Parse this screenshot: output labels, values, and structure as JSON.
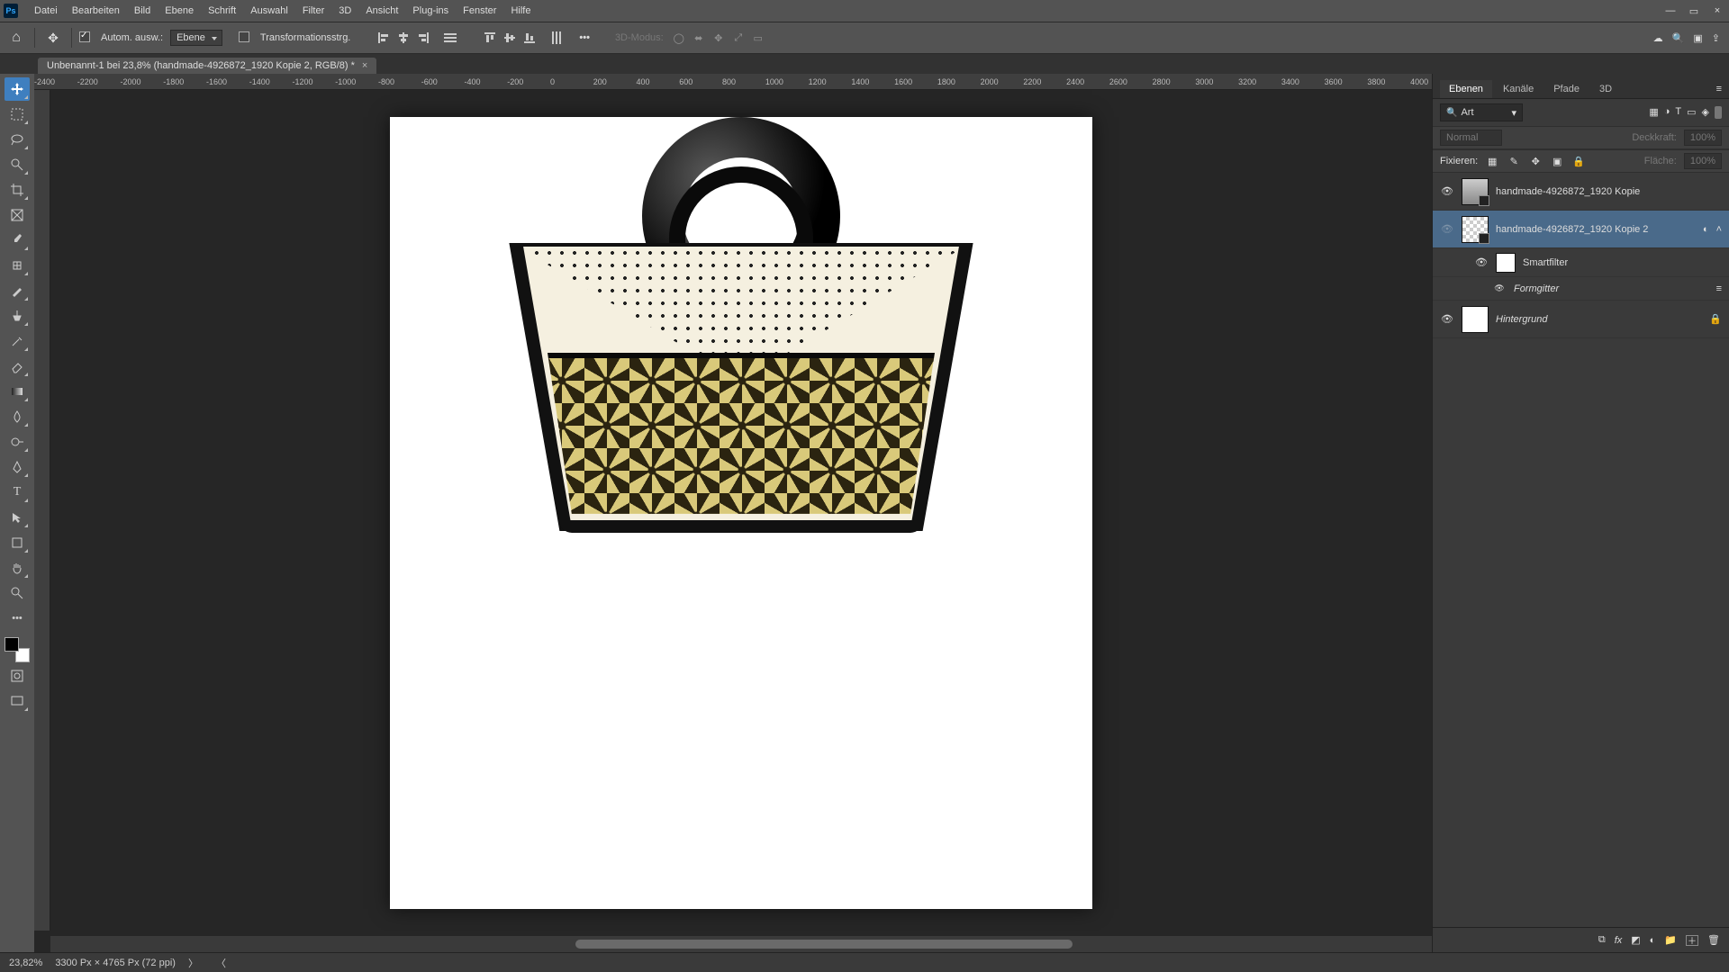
{
  "app": {
    "logo_text": "Ps"
  },
  "menu": {
    "items": [
      "Datei",
      "Bearbeiten",
      "Bild",
      "Ebene",
      "Schrift",
      "Auswahl",
      "Filter",
      "3D",
      "Ansicht",
      "Plug-ins",
      "Fenster",
      "Hilfe"
    ]
  },
  "options": {
    "auto_select_label": "Autom. ausw.:",
    "auto_select_target": "Ebene",
    "show_transform_label": "Transformationsstrg.",
    "threeD_mode_label": "3D-Modus:"
  },
  "document": {
    "tab_title": "Unbenannt-1 bei 23,8% (handmade-4926872_1920 Kopie 2, RGB/8) *"
  },
  "ruler": {
    "h_ticks": [
      "-2400",
      "-2200",
      "-2000",
      "-1800",
      "-1600",
      "-1400",
      "-1200",
      "-1000",
      "-800",
      "-600",
      "-400",
      "-200",
      "0",
      "200",
      "400",
      "600",
      "800",
      "1000",
      "1200",
      "1400",
      "1600",
      "1800",
      "2000",
      "2200",
      "2400",
      "2600",
      "2800",
      "3000",
      "3200",
      "3400",
      "3600",
      "3800",
      "4000"
    ]
  },
  "panels": {
    "tabs": [
      "Ebenen",
      "Kanäle",
      "Pfade",
      "3D"
    ],
    "search_mode": "Art",
    "blend_mode": "Normal",
    "opacity_label": "Deckkraft:",
    "opacity_value": "100%",
    "lock_label": "Fixieren:",
    "fill_label": "Fläche:",
    "fill_value": "100%"
  },
  "layers": [
    {
      "visible": true,
      "name": "handmade-4926872_1920 Kopie",
      "smart": true,
      "selected": false
    },
    {
      "visible": false,
      "name": "handmade-4926872_1920 Kopie 2",
      "smart": true,
      "selected": true,
      "filter_icon": true
    },
    {
      "sub": 1,
      "visible": true,
      "name": "Smartfilter"
    },
    {
      "sub": 2,
      "visible": true,
      "name": "Formgitter"
    },
    {
      "visible": true,
      "name": "Hintergrund",
      "locked": true,
      "italic": true
    }
  ],
  "status": {
    "zoom": "23,82%",
    "doc_size": "3300 Px × 4765 Px (72 ppi)"
  },
  "icons": {
    "home": "⌂",
    "move": "✥",
    "search": "🔍",
    "close": "×",
    "minimize": "—",
    "restore": "▭",
    "eye": "👁",
    "lock": "🔒",
    "trash": "🗑",
    "folder": "📁",
    "mask": "◩",
    "newlayer": "＋",
    "fx": "fx",
    "link": "⧉",
    "adjust": "◐",
    "gear": "⚙",
    "share": "⇪",
    "frame": "▣",
    "filter_img": "▦",
    "filter_adj": "◑",
    "filter_type": "T",
    "filter_shape": "▭",
    "filter_smart": "◈"
  }
}
